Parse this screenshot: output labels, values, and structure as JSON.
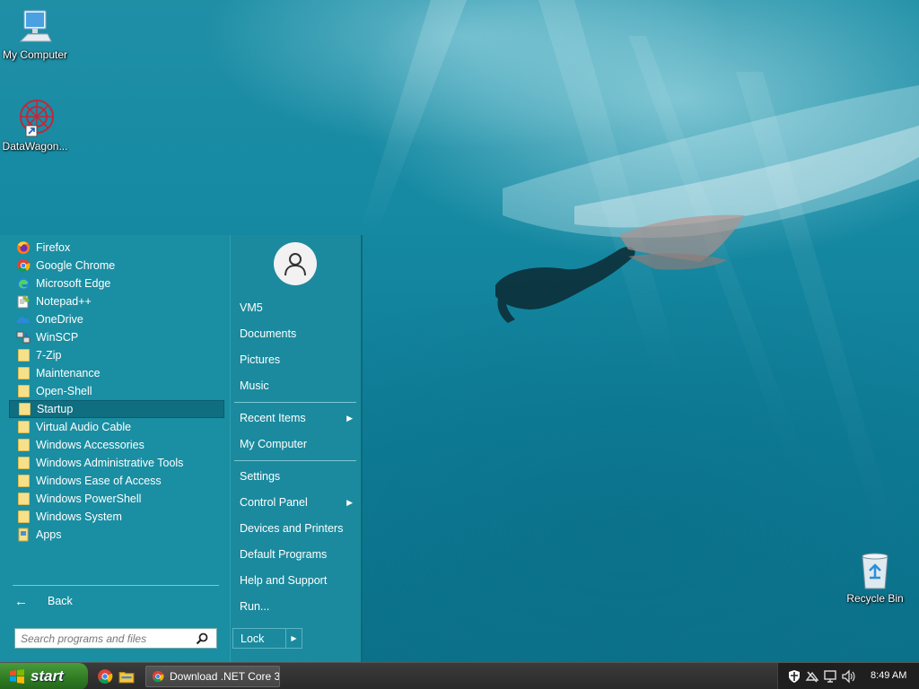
{
  "desktop": {
    "icons": [
      {
        "label": "My Computer",
        "icon": "computer-icon"
      },
      {
        "label": "DataWagon...",
        "icon": "datawagon-shortcut-icon"
      },
      {
        "label": "Recycle Bin",
        "icon": "recycle-bin-icon"
      }
    ]
  },
  "start_menu": {
    "programs": [
      {
        "label": "Firefox",
        "icon": "firefox-icon"
      },
      {
        "label": "Google Chrome",
        "icon": "chrome-icon"
      },
      {
        "label": "Microsoft Edge",
        "icon": "edge-icon"
      },
      {
        "label": "Notepad++",
        "icon": "notepad-plus-plus-icon"
      },
      {
        "label": "OneDrive",
        "icon": "onedrive-icon"
      },
      {
        "label": "WinSCP",
        "icon": "winscp-icon"
      },
      {
        "label": "7-Zip",
        "icon": "folder-icon"
      },
      {
        "label": "Maintenance",
        "icon": "folder-icon"
      },
      {
        "label": "Open-Shell",
        "icon": "folder-icon"
      },
      {
        "label": "Startup",
        "icon": "folder-icon",
        "selected": true
      },
      {
        "label": "Virtual Audio Cable",
        "icon": "folder-icon"
      },
      {
        "label": "Windows Accessories",
        "icon": "folder-icon"
      },
      {
        "label": "Windows Administrative Tools",
        "icon": "folder-icon"
      },
      {
        "label": "Windows Ease of Access",
        "icon": "folder-icon"
      },
      {
        "label": "Windows PowerShell",
        "icon": "folder-icon"
      },
      {
        "label": "Windows System",
        "icon": "folder-icon"
      },
      {
        "label": "Apps",
        "icon": "apps-icon"
      }
    ],
    "back_label": "Back",
    "search_placeholder": "Search programs and files",
    "right": {
      "user": "VM5",
      "documents": "Documents",
      "pictures": "Pictures",
      "music": "Music",
      "recent_items": "Recent Items",
      "my_computer": "My Computer",
      "settings": "Settings",
      "control_panel": "Control Panel",
      "devices_printers": "Devices and Printers",
      "default_programs": "Default Programs",
      "help_support": "Help and Support",
      "run": "Run...",
      "lock": "Lock"
    }
  },
  "taskbar": {
    "start_label": "start",
    "task_chrome_label": "Download .NET Core 3...",
    "clock": "8:49 AM"
  },
  "colors": {
    "menu_bg": "#1a8ea2",
    "menu_selected": "#0f6e80",
    "taskbar_bg": "#2a2a2a",
    "start_green": "#2e7a22"
  }
}
